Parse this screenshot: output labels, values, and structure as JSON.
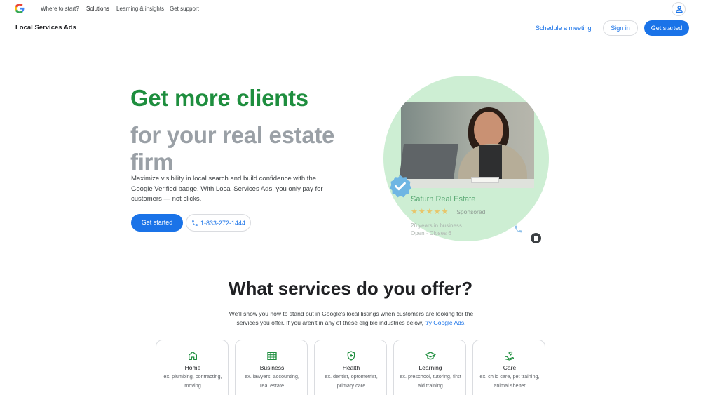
{
  "topnav": {
    "logo_icon": "google-g-icon",
    "items": [
      {
        "label": "Where to start?"
      },
      {
        "label": "Solutions"
      },
      {
        "label": "Learning & insights"
      },
      {
        "label": "Get support"
      }
    ],
    "active_item": "Solutions",
    "account_icon": "account-icon"
  },
  "productbar": {
    "product_name": "Local Services Ads",
    "schedule_label": "Schedule a meeting",
    "signin_label": "Sign in",
    "get_started_label": "Get started"
  },
  "hero": {
    "title": "Get more clients",
    "subtitle": "for your real estate firm",
    "description": "Maximize visibility in local search and build confidence with the Google Verified badge. With Local Services Ads, you only pay for customers — not clicks.",
    "cta_label": "Get started",
    "phone_label": "1-833-272-1444",
    "phone_icon": "phone-icon"
  },
  "ad_card": {
    "business_name": "Saturn Real Estate",
    "stars": "★★★★★",
    "rating": 5,
    "separator": "·",
    "sponsored_label": "Sponsored",
    "years_text": "26 years in business",
    "hours_text": "Open · Closes 6",
    "badge_icon": "verified-badge-icon",
    "call_icon": "phone-icon",
    "pause_icon": "pause-icon"
  },
  "services": {
    "heading": "What services do you offer?",
    "description": "We'll show you how to stand out in Google's local listings when customers are looking for the services you offer. If you aren't in any of these eligible industries below,",
    "link_label": "try Google Ads",
    "link_suffix": ".",
    "cards": [
      {
        "title": "Home",
        "desc": "ex. plumbing, contracting, moving",
        "icon": "home-icon"
      },
      {
        "title": "Business",
        "desc": "ex. lawyers, accounting, real estate",
        "icon": "building-icon"
      },
      {
        "title": "Health",
        "desc": "ex. dentist, optometrist, primary care",
        "icon": "health-shield-icon"
      },
      {
        "title": "Learning",
        "desc": "ex. preschool, tutoring, first aid training",
        "icon": "graduation-cap-icon"
      },
      {
        "title": "Care",
        "desc": "ex. child care, pet training, animal shelter",
        "icon": "care-heart-icon"
      }
    ]
  },
  "colors": {
    "brand_blue": "#1a73e8",
    "brand_green": "#1e8e3e",
    "subtitle_gray": "#9aa0a6",
    "circle_green": "#cdeed3"
  }
}
